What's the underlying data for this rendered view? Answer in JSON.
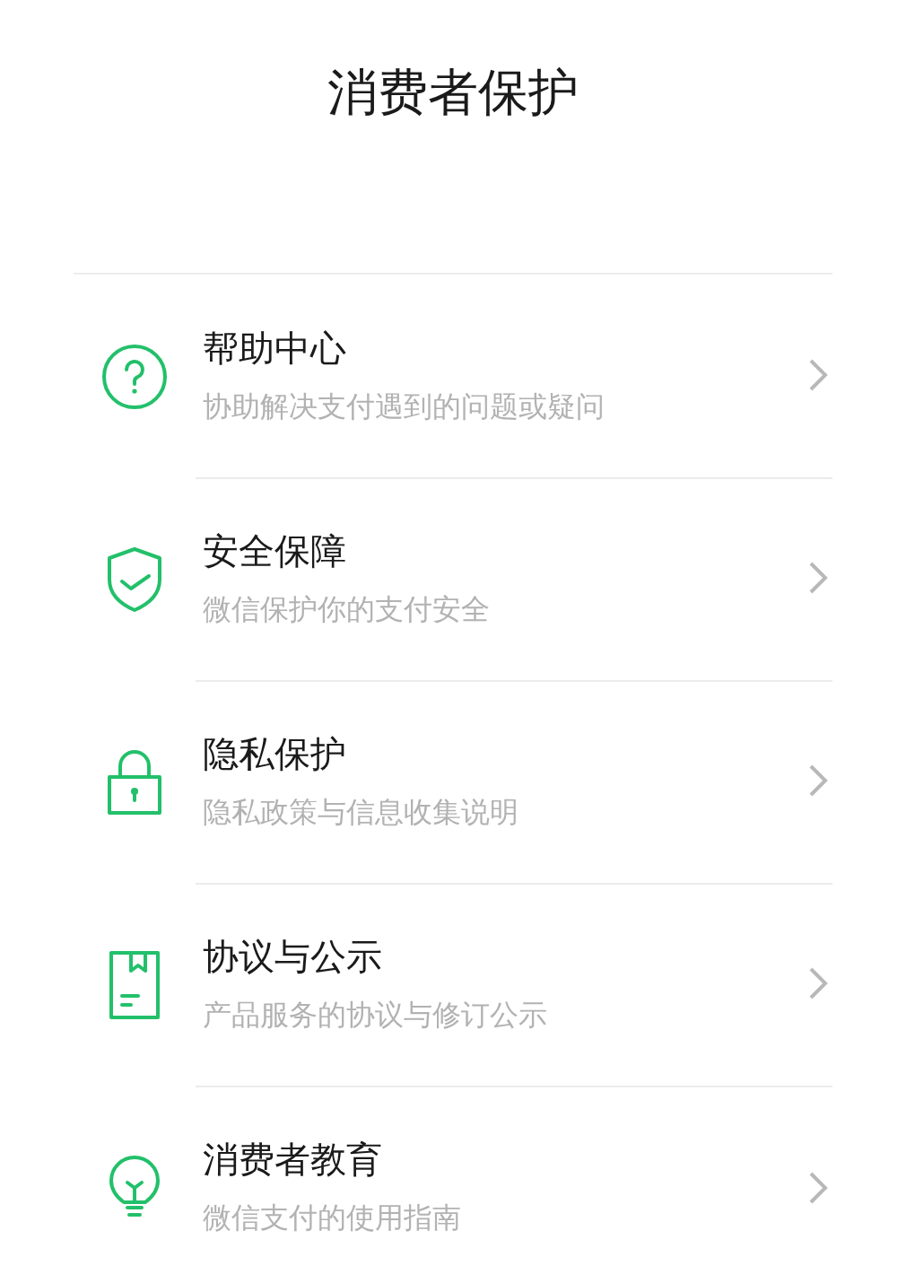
{
  "header": {
    "title": "消费者保护"
  },
  "items": [
    {
      "kind": "help",
      "title": "帮助中心",
      "subtitle": "协助解决支付遇到的问题或疑问"
    },
    {
      "kind": "shield",
      "title": "安全保障",
      "subtitle": "微信保护你的支付安全"
    },
    {
      "kind": "lock",
      "title": "隐私保护",
      "subtitle": "隐私政策与信息收集说明"
    },
    {
      "kind": "document",
      "title": "协议与公示",
      "subtitle": "产品服务的协议与修订公示"
    },
    {
      "kind": "bulb",
      "title": "消费者教育",
      "subtitle": "微信支付的使用指南"
    }
  ]
}
